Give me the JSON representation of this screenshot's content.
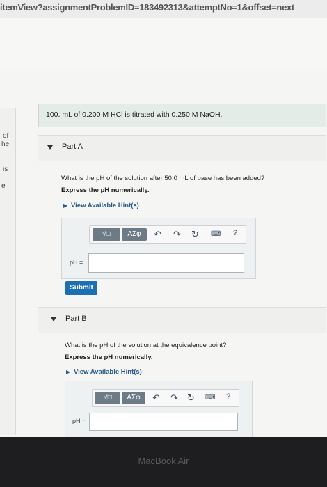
{
  "browser": {
    "url_fragment": "itemView?assignmentProblemID=183492313&attemptNo=1&offset=next"
  },
  "left_edge": {
    "line1": "of",
    "line2": "he",
    "line3": "is",
    "line4": "e"
  },
  "problem": {
    "statement": "100. mL of 0.200 M HCl is titrated with 0.250 M NaOH."
  },
  "part_a": {
    "title": "Part A",
    "question": "What is the pH of the solution after 50.0 mL of base has been added?",
    "instruction": "Express the pH numerically.",
    "hint_link": "View Available Hint(s)",
    "label": "pH =",
    "value": "",
    "submit_label": "Submit"
  },
  "part_b": {
    "title": "Part B",
    "question": "What is the pH of the solution at the equivalence point?",
    "instruction": "Express the pH numerically.",
    "hint_link": "View Available Hint(s)",
    "label": "pH =",
    "value": ""
  },
  "toolbar": {
    "template_label": "√□",
    "symbols_label": "ΑΣφ",
    "undo_icon": "undo-icon",
    "redo_icon": "redo-icon",
    "reset_icon": "reset-icon",
    "keyboard_icon": "keyboard-icon",
    "help_label": "?"
  },
  "device": {
    "brand": "MacBook Air"
  }
}
